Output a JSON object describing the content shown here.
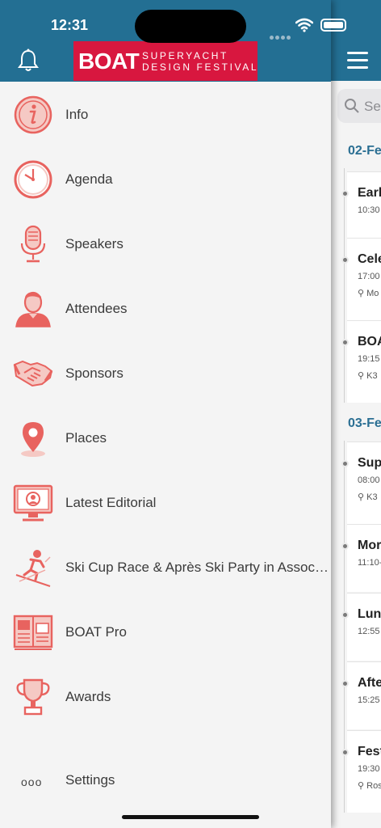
{
  "status_bar": {
    "time": "12:31"
  },
  "drawer": {
    "logo": {
      "brand": "BOAT",
      "line1": "SUPERYACHT",
      "line2": "DESIGN FESTIVAL"
    },
    "items": [
      {
        "label": "Info",
        "icon": "info-icon"
      },
      {
        "label": "Agenda",
        "icon": "clock-icon"
      },
      {
        "label": "Speakers",
        "icon": "microphone-icon"
      },
      {
        "label": "Attendees",
        "icon": "person-icon"
      },
      {
        "label": "Sponsors",
        "icon": "handshake-icon"
      },
      {
        "label": "Places",
        "icon": "map-pin-icon"
      },
      {
        "label": "Latest Editorial",
        "icon": "monitor-icon"
      },
      {
        "label": "Ski Cup Race & Après Ski Party in Associati...",
        "icon": "skier-icon"
      },
      {
        "label": "BOAT Pro",
        "icon": "magazine-icon"
      },
      {
        "label": "Awards",
        "icon": "trophy-icon"
      }
    ],
    "settings": {
      "label": "Settings",
      "icon": "more-dots-icon",
      "glyph": "ooo"
    }
  },
  "agenda_panel": {
    "search_placeholder": "Sea",
    "dates": [
      "02-Fe",
      "03-Fe"
    ],
    "events": [
      {
        "title": "Earl",
        "time": "10:30",
        "place": ""
      },
      {
        "title": "Cele",
        "time": "17:00",
        "place": "Mo"
      },
      {
        "title": "BOA",
        "time": "19:15",
        "place": "K3"
      },
      {
        "title": "Sup",
        "time": "08:00",
        "place": "K3"
      },
      {
        "title": "Mor",
        "time": "11:10-",
        "place": ""
      },
      {
        "title": "Lun",
        "time": "12:55",
        "place": ""
      },
      {
        "title": "Afte",
        "time": "15:25",
        "place": ""
      },
      {
        "title": "Fest",
        "time": "19:30",
        "place": "Ros"
      }
    ]
  },
  "colors": {
    "header": "#236f93",
    "accent": "#e8635f",
    "brand_red": "#d8173f"
  }
}
